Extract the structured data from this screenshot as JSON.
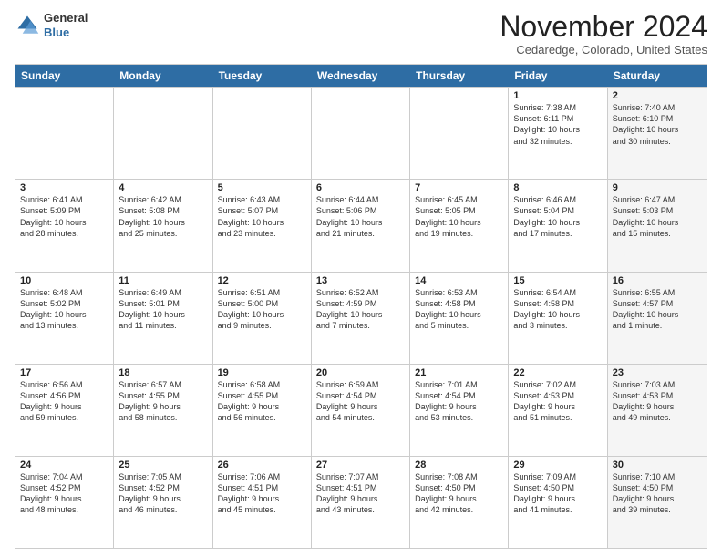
{
  "logo": {
    "general": "General",
    "blue": "Blue"
  },
  "header": {
    "month": "November 2024",
    "location": "Cedaredge, Colorado, United States"
  },
  "days_of_week": [
    "Sunday",
    "Monday",
    "Tuesday",
    "Wednesday",
    "Thursday",
    "Friday",
    "Saturday"
  ],
  "weeks": [
    [
      {
        "day": "",
        "info": "",
        "shaded": false
      },
      {
        "day": "",
        "info": "",
        "shaded": false
      },
      {
        "day": "",
        "info": "",
        "shaded": false
      },
      {
        "day": "",
        "info": "",
        "shaded": false
      },
      {
        "day": "",
        "info": "",
        "shaded": false
      },
      {
        "day": "1",
        "info": "Sunrise: 7:38 AM\nSunset: 6:11 PM\nDaylight: 10 hours\nand 32 minutes.",
        "shaded": false
      },
      {
        "day": "2",
        "info": "Sunrise: 7:40 AM\nSunset: 6:10 PM\nDaylight: 10 hours\nand 30 minutes.",
        "shaded": true
      }
    ],
    [
      {
        "day": "3",
        "info": "Sunrise: 6:41 AM\nSunset: 5:09 PM\nDaylight: 10 hours\nand 28 minutes.",
        "shaded": false
      },
      {
        "day": "4",
        "info": "Sunrise: 6:42 AM\nSunset: 5:08 PM\nDaylight: 10 hours\nand 25 minutes.",
        "shaded": false
      },
      {
        "day": "5",
        "info": "Sunrise: 6:43 AM\nSunset: 5:07 PM\nDaylight: 10 hours\nand 23 minutes.",
        "shaded": false
      },
      {
        "day": "6",
        "info": "Sunrise: 6:44 AM\nSunset: 5:06 PM\nDaylight: 10 hours\nand 21 minutes.",
        "shaded": false
      },
      {
        "day": "7",
        "info": "Sunrise: 6:45 AM\nSunset: 5:05 PM\nDaylight: 10 hours\nand 19 minutes.",
        "shaded": false
      },
      {
        "day": "8",
        "info": "Sunrise: 6:46 AM\nSunset: 5:04 PM\nDaylight: 10 hours\nand 17 minutes.",
        "shaded": false
      },
      {
        "day": "9",
        "info": "Sunrise: 6:47 AM\nSunset: 5:03 PM\nDaylight: 10 hours\nand 15 minutes.",
        "shaded": true
      }
    ],
    [
      {
        "day": "10",
        "info": "Sunrise: 6:48 AM\nSunset: 5:02 PM\nDaylight: 10 hours\nand 13 minutes.",
        "shaded": false
      },
      {
        "day": "11",
        "info": "Sunrise: 6:49 AM\nSunset: 5:01 PM\nDaylight: 10 hours\nand 11 minutes.",
        "shaded": false
      },
      {
        "day": "12",
        "info": "Sunrise: 6:51 AM\nSunset: 5:00 PM\nDaylight: 10 hours\nand 9 minutes.",
        "shaded": false
      },
      {
        "day": "13",
        "info": "Sunrise: 6:52 AM\nSunset: 4:59 PM\nDaylight: 10 hours\nand 7 minutes.",
        "shaded": false
      },
      {
        "day": "14",
        "info": "Sunrise: 6:53 AM\nSunset: 4:58 PM\nDaylight: 10 hours\nand 5 minutes.",
        "shaded": false
      },
      {
        "day": "15",
        "info": "Sunrise: 6:54 AM\nSunset: 4:58 PM\nDaylight: 10 hours\nand 3 minutes.",
        "shaded": false
      },
      {
        "day": "16",
        "info": "Sunrise: 6:55 AM\nSunset: 4:57 PM\nDaylight: 10 hours\nand 1 minute.",
        "shaded": true
      }
    ],
    [
      {
        "day": "17",
        "info": "Sunrise: 6:56 AM\nSunset: 4:56 PM\nDaylight: 9 hours\nand 59 minutes.",
        "shaded": false
      },
      {
        "day": "18",
        "info": "Sunrise: 6:57 AM\nSunset: 4:55 PM\nDaylight: 9 hours\nand 58 minutes.",
        "shaded": false
      },
      {
        "day": "19",
        "info": "Sunrise: 6:58 AM\nSunset: 4:55 PM\nDaylight: 9 hours\nand 56 minutes.",
        "shaded": false
      },
      {
        "day": "20",
        "info": "Sunrise: 6:59 AM\nSunset: 4:54 PM\nDaylight: 9 hours\nand 54 minutes.",
        "shaded": false
      },
      {
        "day": "21",
        "info": "Sunrise: 7:01 AM\nSunset: 4:54 PM\nDaylight: 9 hours\nand 53 minutes.",
        "shaded": false
      },
      {
        "day": "22",
        "info": "Sunrise: 7:02 AM\nSunset: 4:53 PM\nDaylight: 9 hours\nand 51 minutes.",
        "shaded": false
      },
      {
        "day": "23",
        "info": "Sunrise: 7:03 AM\nSunset: 4:53 PM\nDaylight: 9 hours\nand 49 minutes.",
        "shaded": true
      }
    ],
    [
      {
        "day": "24",
        "info": "Sunrise: 7:04 AM\nSunset: 4:52 PM\nDaylight: 9 hours\nand 48 minutes.",
        "shaded": false
      },
      {
        "day": "25",
        "info": "Sunrise: 7:05 AM\nSunset: 4:52 PM\nDaylight: 9 hours\nand 46 minutes.",
        "shaded": false
      },
      {
        "day": "26",
        "info": "Sunrise: 7:06 AM\nSunset: 4:51 PM\nDaylight: 9 hours\nand 45 minutes.",
        "shaded": false
      },
      {
        "day": "27",
        "info": "Sunrise: 7:07 AM\nSunset: 4:51 PM\nDaylight: 9 hours\nand 43 minutes.",
        "shaded": false
      },
      {
        "day": "28",
        "info": "Sunrise: 7:08 AM\nSunset: 4:50 PM\nDaylight: 9 hours\nand 42 minutes.",
        "shaded": false
      },
      {
        "day": "29",
        "info": "Sunrise: 7:09 AM\nSunset: 4:50 PM\nDaylight: 9 hours\nand 41 minutes.",
        "shaded": false
      },
      {
        "day": "30",
        "info": "Sunrise: 7:10 AM\nSunset: 4:50 PM\nDaylight: 9 hours\nand 39 minutes.",
        "shaded": true
      }
    ]
  ]
}
